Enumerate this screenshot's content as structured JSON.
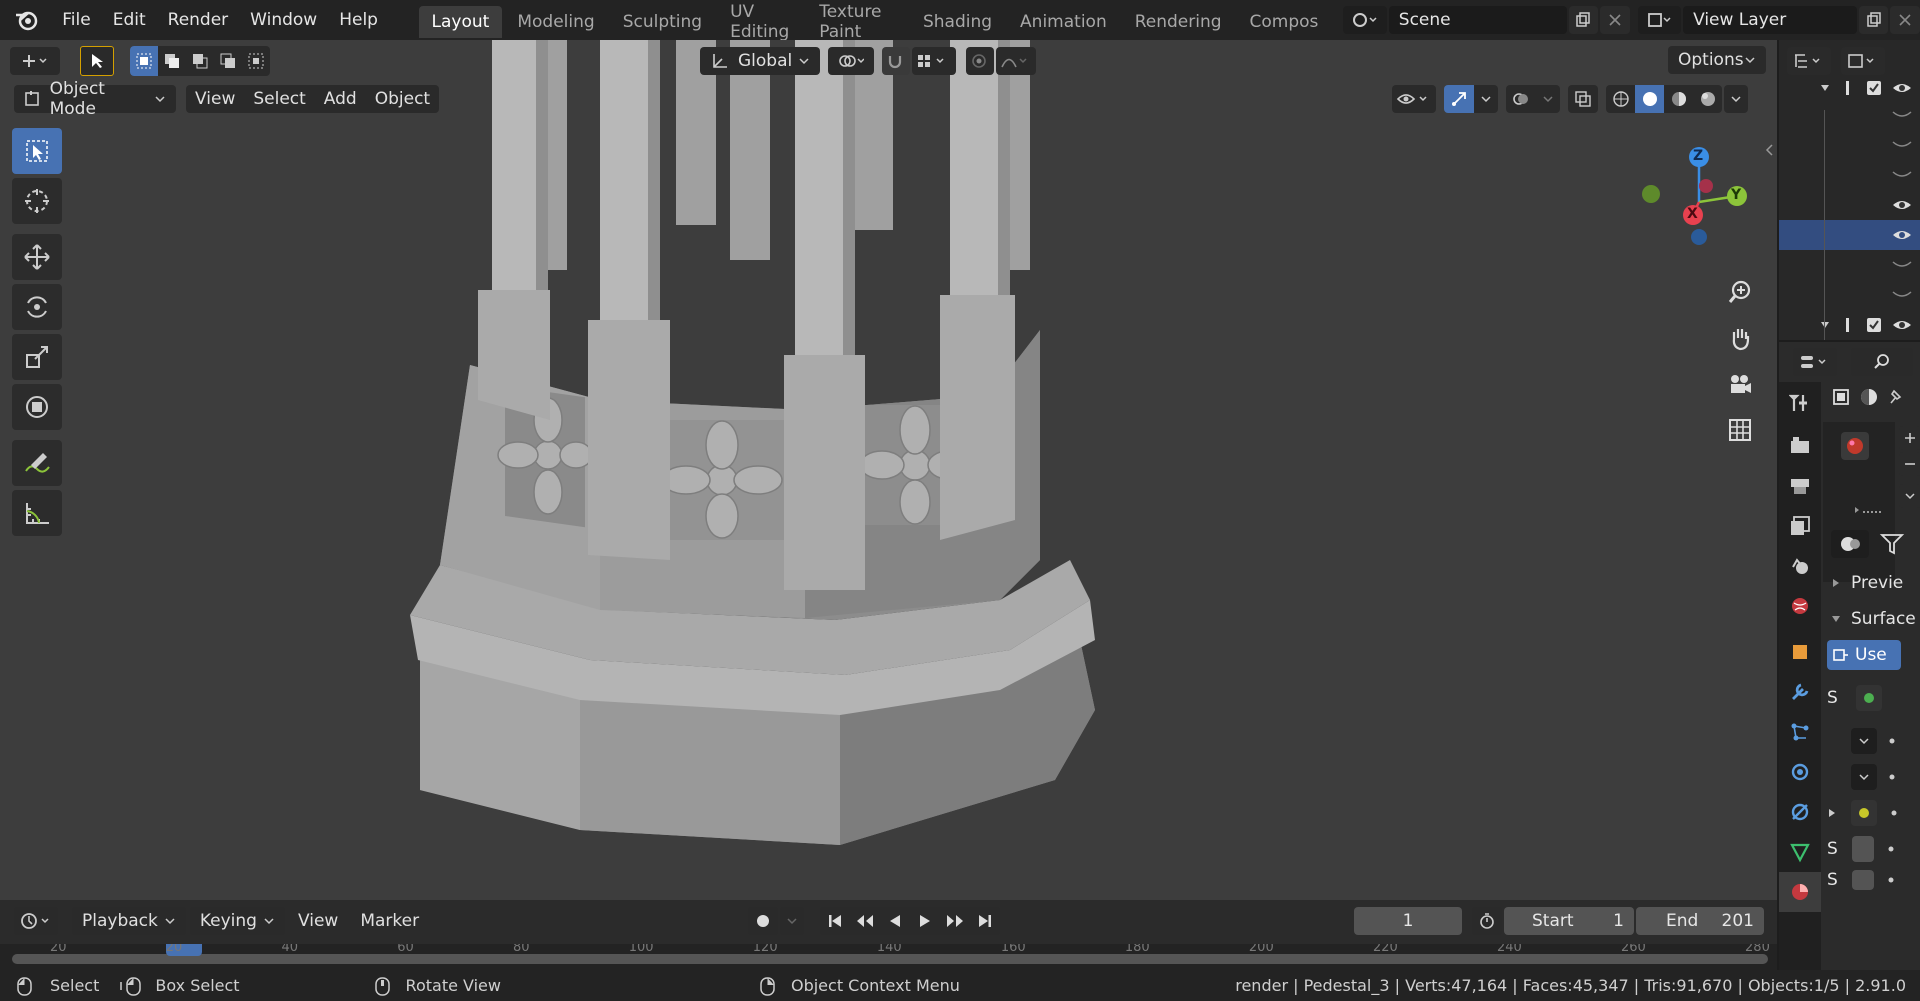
{
  "topbar": {
    "menus": [
      "File",
      "Edit",
      "Render",
      "Window",
      "Help"
    ],
    "workspaces": [
      "Layout",
      "Modeling",
      "Sculpting",
      "UV Editing",
      "Texture Paint",
      "Shading",
      "Animation",
      "Rendering",
      "Compos"
    ],
    "active_workspace": "Layout",
    "scene_label": "Scene",
    "view_layer_label": "View Layer"
  },
  "viewport_header": {
    "transform_orientation": "Global",
    "options_label": "Options",
    "mode_label": "Object Mode",
    "menus": [
      "View",
      "Select",
      "Add",
      "Object"
    ]
  },
  "gizmo": {
    "z_label": "Z",
    "y_label": "Y",
    "x_label": "X",
    "colors": {
      "x": "#e8414f",
      "y": "#8cc43a",
      "z": "#3a8ee6"
    }
  },
  "timeline": {
    "menus": [
      "Playback",
      "Keying",
      "View",
      "Marker"
    ],
    "current_frame": "1",
    "start_label": "Start",
    "start_value": "1",
    "end_label": "End",
    "end_value": "201",
    "ruler_labels": [
      "20",
      "",
      "20",
      "40",
      "60",
      "80",
      "100",
      "120",
      "140",
      "160",
      "180",
      "200",
      "220",
      "240",
      "260",
      "280"
    ]
  },
  "statusbar": {
    "select_label": "Select",
    "box_select_label": "Box Select",
    "rotate_view_label": "Rotate View",
    "context_menu_label": "Object Context Menu",
    "stats": "render | Pedestal_3 | Verts:47,164 | Faces:45,347 | Tris:91,670 | Objects:1/5 | 2.91.0"
  },
  "properties": {
    "preview_label": "Previe",
    "surface_label": "Surface",
    "use_nodes_label": "Use",
    "s_label_1": "S",
    "s_label_2": "S",
    "s_label_3": "S"
  },
  "colors": {
    "accent": "#4772b3",
    "viewport_bg": "#3d3d3d",
    "model": "#9a9a9a"
  }
}
